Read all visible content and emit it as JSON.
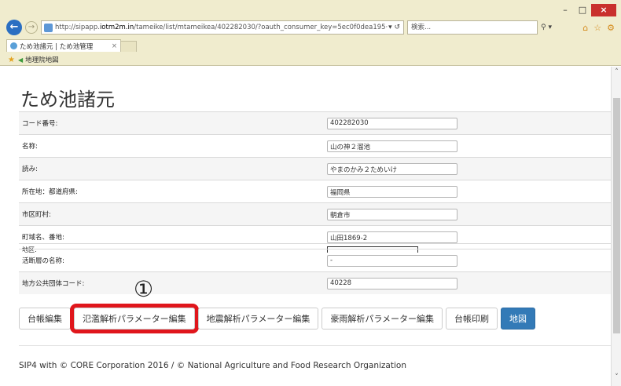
{
  "window": {
    "minimize": "–",
    "maximize": "□",
    "close": "×"
  },
  "browser": {
    "back": "←",
    "forward": "→",
    "address_prefix": "http://sipapp.",
    "address_host": "iotm2m.in",
    "address_path": "/tameike/list/mtameikea/402282030/?oauth_consumer_key=5ec0f0dea195·",
    "address_controls": "▾ ↺",
    "search_placeholder": "検索...",
    "search_control": "⚲ ▾",
    "tab_title": "ため池諸元 | ため池管理",
    "tab_close": "×",
    "favorite_label": "地理院地図"
  },
  "page": {
    "title": "ため池諸元",
    "rows": [
      {
        "label": "コード番号:",
        "value": "402282030"
      },
      {
        "label": "名称:",
        "value": "山の神２溜池"
      },
      {
        "label": "読み:",
        "value": "やまのかみ２ためいけ"
      },
      {
        "label": "所在地：都道府県:",
        "value": "福岡県"
      },
      {
        "label": "市区町村:",
        "value": "朝倉市"
      },
      {
        "label": "町域名、番地:",
        "value": "山田1869-2"
      }
    ],
    "glitch_label": "地区:",
    "rows2": [
      {
        "label": "活断層の名称:",
        "value": "-"
      },
      {
        "label": "地方公共団体コード:",
        "value": "40228"
      }
    ],
    "buttons": {
      "ledger_edit": "台帳編集",
      "flood_params": "氾濫解析パラメーター編集",
      "quake_params": "地震解析パラメーター編集",
      "rain_params": "豪雨解析パラメーター編集",
      "ledger_print": "台帳印刷",
      "map": "地図"
    },
    "step_marker": "①",
    "footer": "SIP4 with © CORE Corporation 2016 / © National Agriculture and Food Research Organization"
  }
}
